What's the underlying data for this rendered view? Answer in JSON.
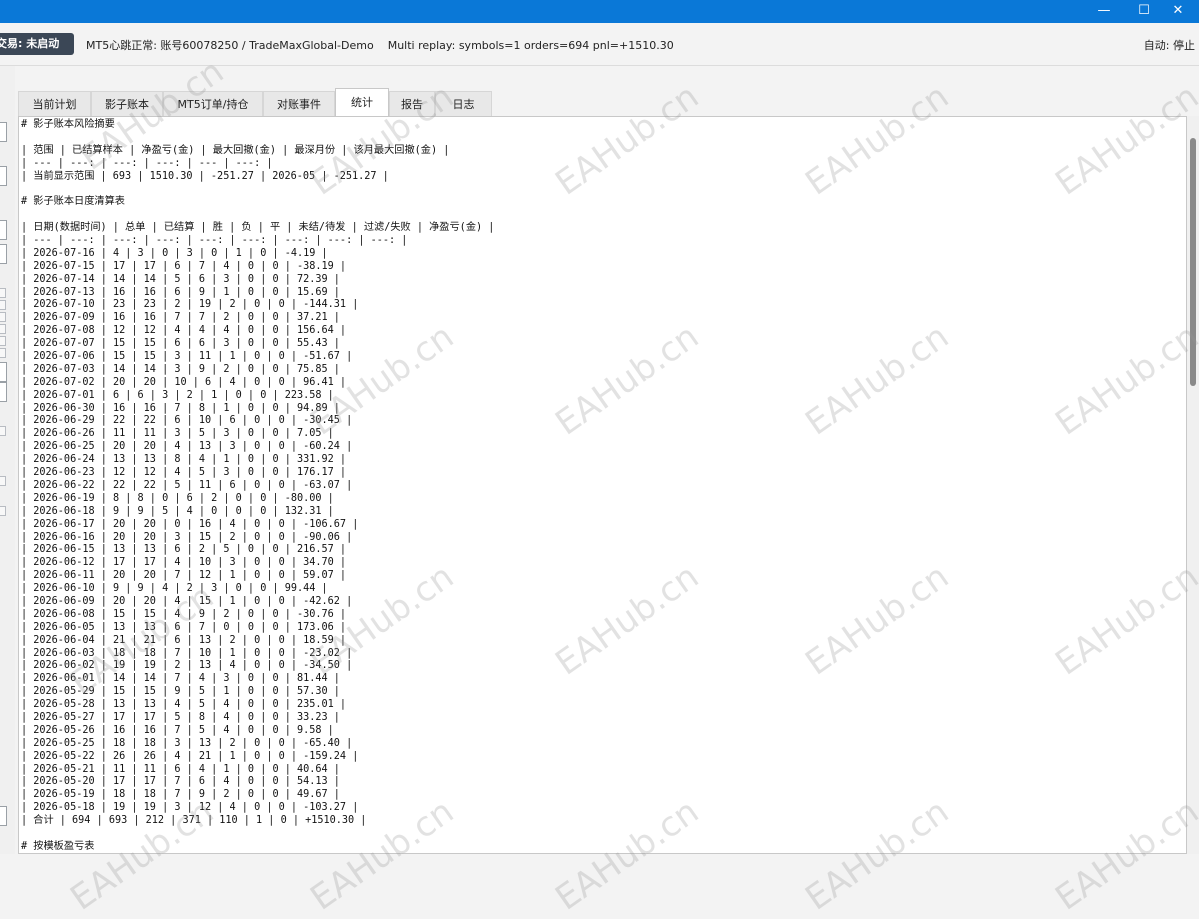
{
  "window": {
    "minimize_glyph": "—",
    "maximize_glyph": "☐",
    "close_glyph": "✕",
    "accent": "#0a78d7"
  },
  "status": {
    "trade_state": "交易: 未启动",
    "heartbeat": "MT5心跳正常: 账号60078250 / TradeMaxGlobal-Demo",
    "replay": "Multi replay: symbols=1 orders=694 pnl=+1510.30",
    "auto": "自动: 停止"
  },
  "tabs": [
    {
      "label": "当前计划"
    },
    {
      "label": "影子账本"
    },
    {
      "label": "MT5订单/持仓"
    },
    {
      "label": "对账事件"
    },
    {
      "label": "统计"
    },
    {
      "label": "报告"
    },
    {
      "label": "日志"
    }
  ],
  "active_tab": "统计",
  "watermark_text": "EAHub.cn",
  "report_lines": [
    "# 影子账本风险摘要",
    "",
    "| 范围 | 已结算样本 | 净盈亏(金) | 最大回撤(金) | 最深月份 | 该月最大回撤(金) |",
    "| --- | ---: | ---: | ---: | --- | ---: |",
    "| 当前显示范围 | 693 | 1510.30 | -251.27 | 2026-05 | -251.27 |",
    "",
    "# 影子账本日度清算表",
    "",
    "| 日期(数据时间) | 总单 | 已结算 | 胜 | 负 | 平 | 未结/待发 | 过滤/失败 | 净盈亏(金) |",
    "| --- | ---: | ---: | ---: | ---: | ---: | ---: | ---: | ---: |",
    "| 2026-07-16 | 4 | 3 | 0 | 3 | 0 | 1 | 0 | -4.19 |",
    "| 2026-07-15 | 17 | 17 | 6 | 7 | 4 | 0 | 0 | -38.19 |",
    "| 2026-07-14 | 14 | 14 | 5 | 6 | 3 | 0 | 0 | 72.39 |",
    "| 2026-07-13 | 16 | 16 | 6 | 9 | 1 | 0 | 0 | 15.69 |",
    "| 2026-07-10 | 23 | 23 | 2 | 19 | 2 | 0 | 0 | -144.31 |",
    "| 2026-07-09 | 16 | 16 | 7 | 7 | 2 | 0 | 0 | 37.21 |",
    "| 2026-07-08 | 12 | 12 | 4 | 4 | 4 | 0 | 0 | 156.64 |",
    "| 2026-07-07 | 15 | 15 | 6 | 6 | 3 | 0 | 0 | 55.43 |",
    "| 2026-07-06 | 15 | 15 | 3 | 11 | 1 | 0 | 0 | -51.67 |",
    "| 2026-07-03 | 14 | 14 | 3 | 9 | 2 | 0 | 0 | 75.85 |",
    "| 2026-07-02 | 20 | 20 | 10 | 6 | 4 | 0 | 0 | 96.41 |",
    "| 2026-07-01 | 6 | 6 | 3 | 2 | 1 | 0 | 0 | 223.58 |",
    "| 2026-06-30 | 16 | 16 | 7 | 8 | 1 | 0 | 0 | 94.89 |",
    "| 2026-06-29 | 22 | 22 | 6 | 10 | 6 | 0 | 0 | -30.45 |",
    "| 2026-06-26 | 11 | 11 | 3 | 5 | 3 | 0 | 0 | 7.05 |",
    "| 2026-06-25 | 20 | 20 | 4 | 13 | 3 | 0 | 0 | -60.24 |",
    "| 2026-06-24 | 13 | 13 | 8 | 4 | 1 | 0 | 0 | 331.92 |",
    "| 2026-06-23 | 12 | 12 | 4 | 5 | 3 | 0 | 0 | 176.17 |",
    "| 2026-06-22 | 22 | 22 | 5 | 11 | 6 | 0 | 0 | -63.07 |",
    "| 2026-06-19 | 8 | 8 | 0 | 6 | 2 | 0 | 0 | -80.00 |",
    "| 2026-06-18 | 9 | 9 | 5 | 4 | 0 | 0 | 0 | 132.31 |",
    "| 2026-06-17 | 20 | 20 | 0 | 16 | 4 | 0 | 0 | -106.67 |",
    "| 2026-06-16 | 20 | 20 | 3 | 15 | 2 | 0 | 0 | -90.06 |",
    "| 2026-06-15 | 13 | 13 | 6 | 2 | 5 | 0 | 0 | 216.57 |",
    "| 2026-06-12 | 17 | 17 | 4 | 10 | 3 | 0 | 0 | 34.70 |",
    "| 2026-06-11 | 20 | 20 | 7 | 12 | 1 | 0 | 0 | 59.07 |",
    "| 2026-06-10 | 9 | 9 | 4 | 2 | 3 | 0 | 0 | 99.44 |",
    "| 2026-06-09 | 20 | 20 | 4 | 15 | 1 | 0 | 0 | -42.62 |",
    "| 2026-06-08 | 15 | 15 | 4 | 9 | 2 | 0 | 0 | -30.76 |",
    "| 2026-06-05 | 13 | 13 | 6 | 7 | 0 | 0 | 0 | 173.06 |",
    "| 2026-06-04 | 21 | 21 | 6 | 13 | 2 | 0 | 0 | 18.59 |",
    "| 2026-06-03 | 18 | 18 | 7 | 10 | 1 | 0 | 0 | -23.02 |",
    "| 2026-06-02 | 19 | 19 | 2 | 13 | 4 | 0 | 0 | -34.50 |",
    "| 2026-06-01 | 14 | 14 | 7 | 4 | 3 | 0 | 0 | 81.44 |",
    "| 2026-05-29 | 15 | 15 | 9 | 5 | 1 | 0 | 0 | 57.30 |",
    "| 2026-05-28 | 13 | 13 | 4 | 5 | 4 | 0 | 0 | 235.01 |",
    "| 2026-05-27 | 17 | 17 | 5 | 8 | 4 | 0 | 0 | 33.23 |",
    "| 2026-05-26 | 16 | 16 | 7 | 5 | 4 | 0 | 0 | 9.58 |",
    "| 2026-05-25 | 18 | 18 | 3 | 13 | 2 | 0 | 0 | -65.40 |",
    "| 2026-05-22 | 26 | 26 | 4 | 21 | 1 | 0 | 0 | -159.24 |",
    "| 2026-05-21 | 11 | 11 | 6 | 4 | 1 | 0 | 0 | 40.64 |",
    "| 2026-05-20 | 17 | 17 | 7 | 6 | 4 | 0 | 0 | 54.13 |",
    "| 2026-05-19 | 18 | 18 | 7 | 9 | 2 | 0 | 0 | 49.67 |",
    "| 2026-05-18 | 19 | 19 | 3 | 12 | 4 | 0 | 0 | -103.27 |",
    "| 合计 | 694 | 693 | 212 | 371 | 110 | 1 | 0 | +1510.30 |",
    "",
    "# 按模板盈亏表"
  ]
}
